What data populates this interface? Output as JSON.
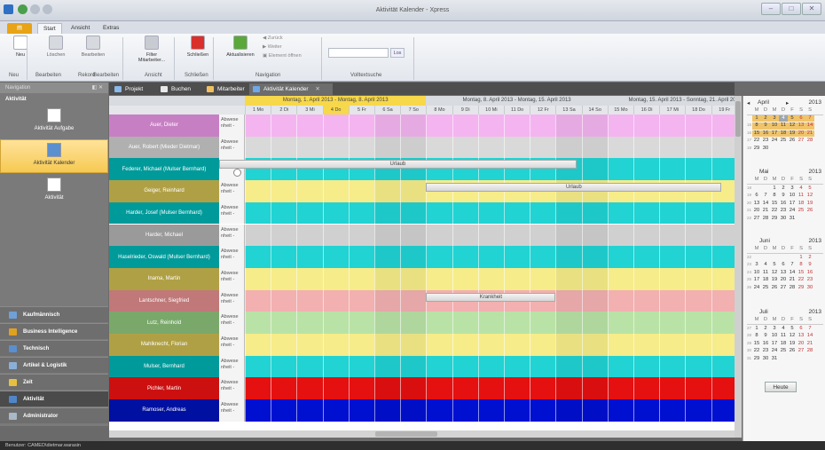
{
  "window": {
    "title": "Aktivität Kalender - Xpress",
    "min": "–",
    "max": "□",
    "close": "✕"
  },
  "ribbon_tabs": [
    {
      "label": "",
      "file": true
    },
    {
      "label": "Start",
      "active": true
    },
    {
      "label": "Ansicht"
    },
    {
      "label": "Extras"
    }
  ],
  "ribbon": {
    "buttons": [
      {
        "label": "Neu",
        "icon": "new-doc-icon",
        "color": "#ffffff",
        "dis": false
      },
      {
        "label": "Löschen",
        "icon": "delete-x-icon",
        "color": "#d6d9dd",
        "dis": true
      },
      {
        "label": "Bearbeiten",
        "icon": "edit-grid-icon",
        "color": "#d6d9dd",
        "dis": true
      },
      {
        "label": "Filter Mitarbeiter...",
        "icon": "filter-icon",
        "color": "#c8ccd2",
        "dis": false
      },
      {
        "label": "Schließen",
        "icon": "close-red-icon",
        "color": "#d9302c",
        "dis": false
      },
      {
        "label": "Aktualisieren",
        "icon": "refresh-icon",
        "color": "#5aa83a",
        "dis": false
      }
    ],
    "nav_small": [
      "Zurück",
      "Weiter",
      "Element öffnen"
    ],
    "search_button": "Los",
    "groups": [
      "Neu",
      "Bearbeiten",
      "Rekord",
      "Bearbeiten",
      "Ansicht",
      "Schließen",
      "Navigation",
      "Volltextsuche"
    ]
  },
  "left_panel": {
    "header": "Navigation",
    "sub": "Aktivität",
    "items": [
      {
        "label": "Aktivität Aufgabe",
        "selected": false
      },
      {
        "label": "Aktivität Kalender",
        "selected": true
      },
      {
        "label": "Aktivität",
        "selected": false
      }
    ],
    "categories": [
      {
        "label": "Kaufmännisch",
        "color": "#6fa0d8"
      },
      {
        "label": "Business Intelligence",
        "color": "#e0a020"
      },
      {
        "label": "Technisch",
        "color": "#5a8fd0"
      },
      {
        "label": "Artikel & Logistik",
        "color": "#8ab0d8"
      },
      {
        "label": "Zeit",
        "color": "#e8c040"
      },
      {
        "label": "Aktivität",
        "color": "#4f86c9",
        "selected": true
      },
      {
        "label": "Administrator",
        "color": "#a8b8c8"
      }
    ]
  },
  "doc_tabs": [
    {
      "label": "Projekt",
      "color": "#8ab8e8"
    },
    {
      "label": "Buchen",
      "color": "#e8e8e8"
    },
    {
      "label": "Mitarbeiter",
      "color": "#f0c060"
    },
    {
      "label": "Aktivität Kalender",
      "color": "#6fa8e8",
      "active": true
    }
  ],
  "calendar": {
    "weeks": [
      "Montag, 1. April 2013 - Montag, 8. April 2013",
      "Montag, 8. April 2013 - Montag, 15. April 2013",
      "Montag, 15. April 2013 - Sonntag, 21. April 2013"
    ],
    "days": [
      "1 Mo",
      "2 Di",
      "3 Mi",
      "4 Do",
      "5 Fr",
      "6 Sa",
      "7 So",
      "8 Mo",
      "9 Di",
      "10 Mi",
      "11 Do",
      "12 Fr",
      "13 Sa",
      "14 So",
      "15 Mo",
      "16 Di",
      "17 Mi",
      "18 Do",
      "19 Fr",
      "20 S"
    ],
    "rows": [
      {
        "name": "Auer, Dieter",
        "abs": "Abwese nheit -",
        "color": "#c77fc4",
        "bg": "#f3b4f0"
      },
      {
        "name": "Auer, Robert (Mieder Dietmar)",
        "abs": "Abwese nheit -",
        "color": "#b0b0b0",
        "bg": "#d9d9d9"
      },
      {
        "name": "Federer, Michael (Mulser Bernhard)",
        "abs": "",
        "color": "#009a9a",
        "bg": "#21d3d3"
      },
      {
        "name": "Geiger, Reinhard",
        "abs": "Abwese nheit -",
        "color": "#b0a045",
        "bg": "#f6ec8a"
      },
      {
        "name": "Harder, Josef (Mulser Bernhard)",
        "abs": "Abwese nheit -",
        "color": "#009a9a",
        "bg": "#21d3d3"
      },
      {
        "name": "Harder, Michael",
        "abs": "Abwese nheit -",
        "color": "#9a9a9a",
        "bg": "#d0d0d0"
      },
      {
        "name": "Haselrieder, Oswald (Mulser Bernhard)",
        "abs": "Abwese nheit -",
        "color": "#009a9a",
        "bg": "#21d3d3"
      },
      {
        "name": "Inama, Martin",
        "abs": "Abwese nheit -",
        "color": "#b0a045",
        "bg": "#f6ec8a"
      },
      {
        "name": "Lantschner, Siegfried",
        "abs": "Abwese nheit -",
        "color": "#c07878",
        "bg": "#f2b0b0"
      },
      {
        "name": "Lutz, Reinhold",
        "abs": "Abwese nheit -",
        "color": "#7aa86a",
        "bg": "#b9e3a6"
      },
      {
        "name": "Mahlknecht, Florian",
        "abs": "Abwese nheit -",
        "color": "#b0a045",
        "bg": "#f6ec8a"
      },
      {
        "name": "Mulser, Bernhard",
        "abs": "Abwese nheit -",
        "color": "#009a9a",
        "bg": "#21d3d3"
      },
      {
        "name": "Pichler, Martin",
        "abs": "Abwese nheit -",
        "color": "#cc1010",
        "bg": "#e51010"
      },
      {
        "name": "Ramoser, Andreas",
        "abs": "Abwese nheit -",
        "color": "#0010a0",
        "bg": "#0010d0"
      }
    ],
    "events": [
      {
        "row": 2,
        "label": "Urlaub",
        "start": 0,
        "end": 12.8
      },
      {
        "row": 3,
        "label": "Urlaub",
        "start": 7,
        "end": 18.4
      },
      {
        "row": 8,
        "label": "Krankheit",
        "start": 7,
        "end": 12
      }
    ]
  },
  "mini_calendar": {
    "months": [
      {
        "name": "April",
        "year": "2013",
        "nav": true,
        "weeks": [
          "14",
          "15",
          "16",
          "17",
          "18"
        ],
        "rows": [
          [
            "",
            "1",
            "2",
            "3",
            "4",
            "5",
            "6",
            "7"
          ],
          [
            "15",
            "8",
            "9",
            "10",
            "11",
            "12",
            "13",
            "14"
          ],
          [
            "16",
            "15",
            "16",
            "17",
            "18",
            "19",
            "20",
            "21"
          ],
          [
            "17",
            "22",
            "23",
            "24",
            "25",
            "26",
            "27",
            "28"
          ],
          [
            "18",
            "29",
            "30",
            "",
            "",
            "",
            "",
            ""
          ]
        ]
      },
      {
        "name": "Mai",
        "year": "2013",
        "rows": [
          [
            "18",
            "",
            "",
            "1",
            "2",
            "3",
            "4",
            "5"
          ],
          [
            "19",
            "6",
            "7",
            "8",
            "9",
            "10",
            "11",
            "12"
          ],
          [
            "20",
            "13",
            "14",
            "15",
            "16",
            "17",
            "18",
            "19"
          ],
          [
            "21",
            "20",
            "21",
            "22",
            "23",
            "24",
            "25",
            "26"
          ],
          [
            "22",
            "27",
            "28",
            "29",
            "30",
            "31",
            "",
            ""
          ]
        ]
      },
      {
        "name": "Juni",
        "year": "2013",
        "rows": [
          [
            "22",
            "",
            "",
            "",
            "",
            "",
            "1",
            "2"
          ],
          [
            "23",
            "3",
            "4",
            "5",
            "6",
            "7",
            "8",
            "9"
          ],
          [
            "24",
            "10",
            "11",
            "12",
            "13",
            "14",
            "15",
            "16"
          ],
          [
            "25",
            "17",
            "18",
            "19",
            "20",
            "21",
            "22",
            "23"
          ],
          [
            "26",
            "24",
            "25",
            "26",
            "27",
            "28",
            "29",
            "30"
          ]
        ]
      },
      {
        "name": "Juli",
        "year": "2013",
        "rows": [
          [
            "27",
            "1",
            "2",
            "3",
            "4",
            "5",
            "6",
            "7"
          ],
          [
            "28",
            "8",
            "9",
            "10",
            "11",
            "12",
            "13",
            "14"
          ],
          [
            "29",
            "15",
            "16",
            "17",
            "18",
            "19",
            "20",
            "21"
          ],
          [
            "30",
            "22",
            "23",
            "24",
            "25",
            "26",
            "27",
            "28"
          ],
          [
            "31",
            "29",
            "30",
            "31",
            "",
            "",
            "",
            ""
          ]
        ]
      }
    ],
    "dow": [
      "M",
      "D",
      "M",
      "D",
      "F",
      "S",
      "S"
    ],
    "today_button": "Heute"
  },
  "status": "Benutzer: CAMED\\dietmar.warasin"
}
